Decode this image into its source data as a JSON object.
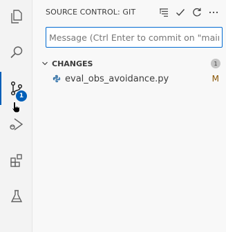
{
  "activity_bar": {
    "badge_count": "1",
    "accent_color": "#005fb8"
  },
  "sidebar": {
    "title": "SOURCE CONTROL: GIT",
    "message_placeholder": "Message (Ctrl Enter to commit on \"main\")",
    "changes_label": "CHANGES",
    "changes_count": "1",
    "files": [
      {
        "name": "eval_obs_avoidance.py",
        "status": "M",
        "icon": "python-file-icon"
      }
    ]
  }
}
